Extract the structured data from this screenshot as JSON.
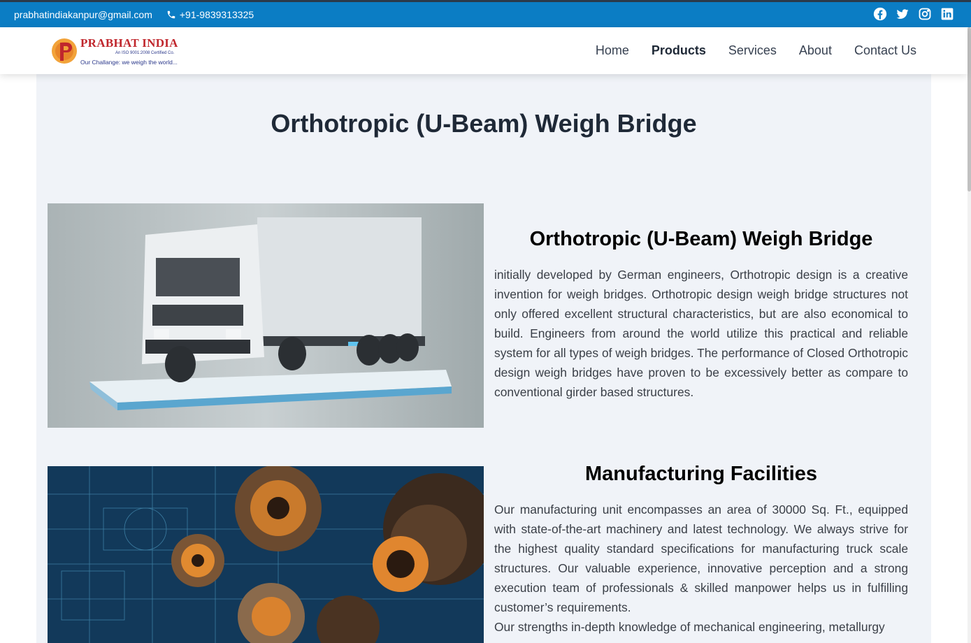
{
  "topbar": {
    "email": "prabhatindiakanpur@gmail.com",
    "phone": "+91-9839313325",
    "social": [
      "facebook-icon",
      "twitter-icon",
      "instagram-icon",
      "linkedin-icon"
    ],
    "bg_color": "#0b7dc4"
  },
  "logo": {
    "brand": "PRABHAT INDIA",
    "iso": "An ISO 9001:2008 Certified Co.",
    "tagline": "Our Challange: we weigh the world..."
  },
  "nav": {
    "items": [
      "Home",
      "Products",
      "Services",
      "About",
      "Contact Us"
    ],
    "active": "Products"
  },
  "page": {
    "title": "Orthotropic (U-Beam) Weigh Bridge"
  },
  "sections": [
    {
      "heading": "Orthotropic (U-Beam) Weigh Bridge",
      "body": "initially developed by German engineers, Orthotropic design is a creative invention for weigh bridges. Orthotropic design weigh bridge structures not only offered excellent structural characteristics, but are also economical to build. Engineers from around the world utilize this practical and reliable system for all types of weigh bridges. The performance of Closed Orthotropic design weigh bridges have proven to be excessively better as compare to conventional girder based structures.",
      "image": "truck-on-weighbridge-image"
    },
    {
      "heading": "Manufacturing Facilities",
      "body": "Our manufacturing unit encompasses an area of 30000 Sq. Ft., equipped with state-of-the-art machinery and latest technology. We always strive for the highest quality standard specifications for manufacturing truck scale structures. Our valuable experience, innovative perception and a strong execution team of professionals & skilled manpower helps us in fulfilling customer’s requirements.",
      "body2": "Our strengths in-depth knowledge of mechanical engineering, metallurgy",
      "image": "gears-blueprint-image"
    }
  ]
}
